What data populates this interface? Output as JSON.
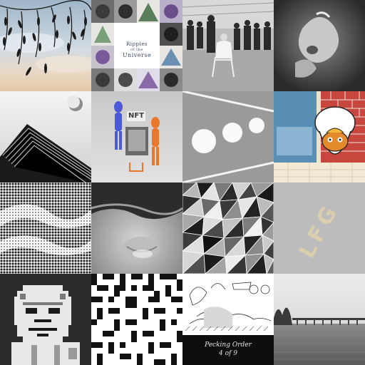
{
  "tiles": [
    {
      "id": "branches-sky",
      "kind": "photo"
    },
    {
      "id": "ripples-universe",
      "kind": "book-cover",
      "title_line1": "Ripples",
      "title_line2": "of the",
      "title_line3": "Universe"
    },
    {
      "id": "crowd-chair",
      "kind": "photo"
    },
    {
      "id": "figure-dark",
      "kind": "photo"
    },
    {
      "id": "pyramid-architecture",
      "kind": "photo"
    },
    {
      "id": "nft-figures",
      "kind": "render",
      "sign_text": "NFT"
    },
    {
      "id": "three-circles",
      "kind": "graphic"
    },
    {
      "id": "toilet-cartoon",
      "kind": "illustration"
    },
    {
      "id": "halftone-wave",
      "kind": "graphic"
    },
    {
      "id": "skin-closeup",
      "kind": "photo"
    },
    {
      "id": "triangle-mosaic",
      "kind": "graphic"
    },
    {
      "id": "dotted-letters",
      "kind": "graphic",
      "letters": "LFG"
    },
    {
      "id": "pixel-ape",
      "kind": "pixel-art"
    },
    {
      "id": "bw-noise-pattern",
      "kind": "graphic"
    },
    {
      "id": "pecking-order",
      "kind": "illustration",
      "caption_title": "Pecking Order",
      "caption_sub": "4 of 9"
    },
    {
      "id": "bridge-sea",
      "kind": "photo"
    }
  ]
}
